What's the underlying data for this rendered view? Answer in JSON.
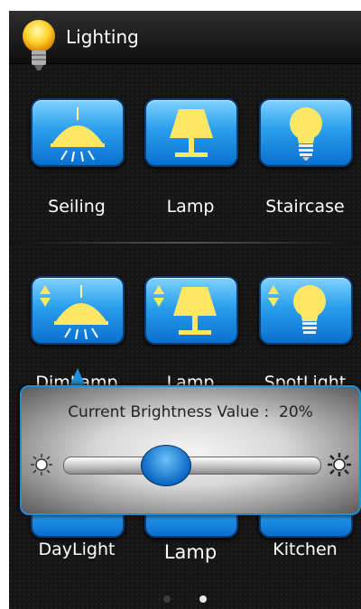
{
  "app": {
    "title": "Lighting"
  },
  "row1": [
    {
      "label": "Seiling",
      "icon": "ceiling-lamp-icon"
    },
    {
      "label": "Lamp",
      "icon": "table-lamp-icon"
    },
    {
      "label": "Staircase",
      "icon": "bulb-icon"
    }
  ],
  "row2": [
    {
      "label": "DimLamp",
      "icon": "dimmable-ceiling-lamp-icon"
    },
    {
      "label": "Lamp",
      "icon": "dimmable-table-lamp-icon"
    },
    {
      "label": "SpotLight",
      "icon": "dimmable-bulb-icon"
    }
  ],
  "row3": [
    {
      "label": "DayLight"
    },
    {
      "label": "Lamp"
    },
    {
      "label": "Kitchen"
    }
  ],
  "brightness": {
    "label": "Current Brightness Value :  20%",
    "value": 0.2
  },
  "pager": {
    "pages": 2,
    "current": 2
  },
  "colors": {
    "accent": "#1e8fd6",
    "tile": "#2a9fec",
    "bulb": "#ffe766"
  }
}
